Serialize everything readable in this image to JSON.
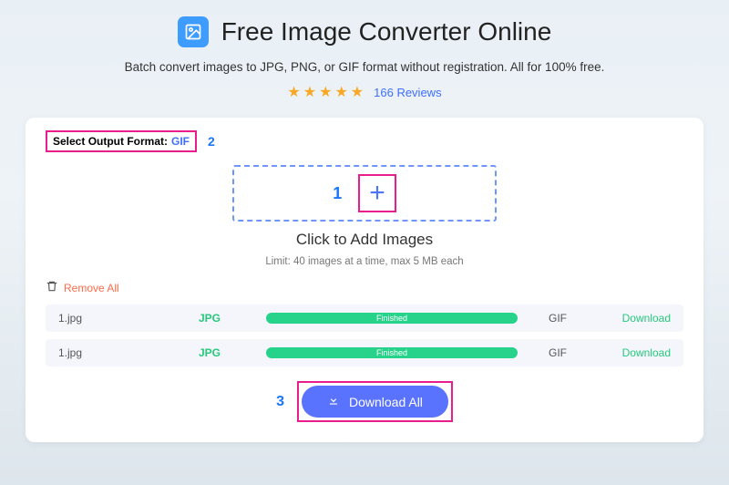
{
  "header": {
    "title": "Free Image Converter Online",
    "subtitle": "Batch convert images to JPG, PNG, or GIF format without registration. All for 100% free.",
    "reviews_count": "166 Reviews"
  },
  "panel": {
    "format_label": "Select Output Format:",
    "format_value": "GIF",
    "step2": "2",
    "step1": "1",
    "add_title": "Click to Add Images",
    "limit_text": "Limit: 40 images at a time, max 5 MB each",
    "remove_all": "Remove All",
    "step3": "3",
    "download_all": "Download All"
  },
  "files": [
    {
      "name": "1.jpg",
      "src": "JPG",
      "status": "Finished",
      "dst": "GIF",
      "action": "Download"
    },
    {
      "name": "1.jpg",
      "src": "JPG",
      "status": "Finished",
      "dst": "GIF",
      "action": "Download"
    }
  ]
}
